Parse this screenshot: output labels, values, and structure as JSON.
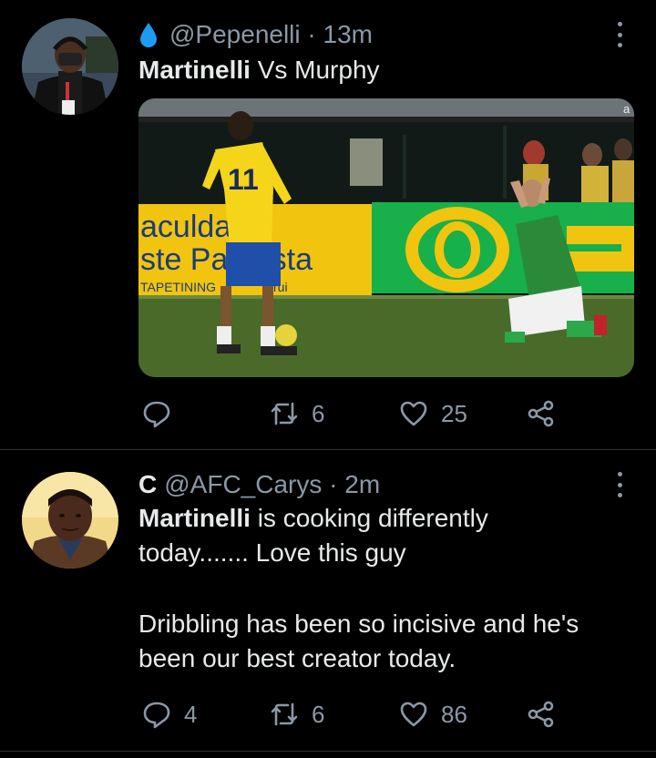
{
  "tweets": [
    {
      "handle": "@Pepenelli",
      "separator": " · ",
      "time": "13m",
      "text_bold": "Martinelli",
      "text_rest": " Vs Murphy",
      "media": {
        "board_text_1": "aculda",
        "board_text_2": "ste Pa     sta",
        "board_text_3": "TAPETINING",
        "board_text_4": "rui",
        "shirt_number": "11",
        "corner_text": "a"
      },
      "actions": {
        "reply": "",
        "retweet": "6",
        "like": "25"
      }
    },
    {
      "name": "C",
      "handle": "@AFC_Carys",
      "separator": " · ",
      "time": "2m",
      "text_bold": "Martinelli",
      "text_line1_rest": " is cooking differently",
      "text_line2": "today....... Love this guy",
      "text_line3": "Dribbling has been so incisive and he's",
      "text_line4": "been our best creator today.",
      "actions": {
        "reply": "4",
        "retweet": "6",
        "like": "86"
      }
    }
  ],
  "colors": {
    "background": "#000000",
    "text": "#e7e9ea",
    "muted": "#8b98a5",
    "divider": "#2f3336",
    "drop_icon": "#1d9bf0"
  }
}
